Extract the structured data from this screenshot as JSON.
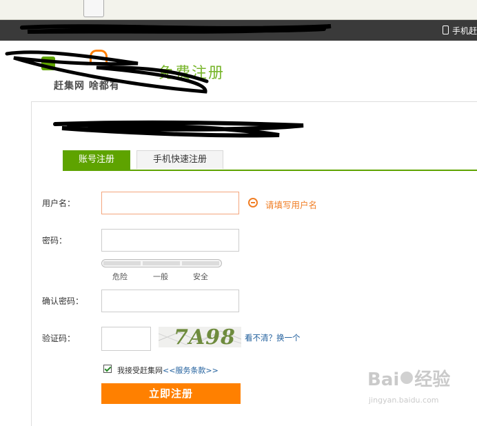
{
  "topbar": {
    "phone_text": "手机赶"
  },
  "header": {
    "page_title": "免费注册",
    "slogan": "赶集网 啥都有"
  },
  "tabs": [
    {
      "label": "账号注册"
    },
    {
      "label": "手机快速注册"
    }
  ],
  "form": {
    "username_label": "用户名：",
    "username_error": "请填写用户名",
    "password_label": "密码：",
    "strength_levels": [
      "危险",
      "一般",
      "安全"
    ],
    "confirm_label": "确认密码：",
    "captcha_label": "验证码：",
    "captcha_text": "7A98",
    "captcha_refresh": "看不清？换一个",
    "agree_prefix": "我接受赶集网",
    "agree_link": "<<服务条款>>",
    "submit_label": "立即注册"
  },
  "watermark": {
    "main_left": "Bai",
    "main_right": "经验",
    "url": "jingyan.baidu.com"
  },
  "colors": {
    "green": "#5ea300",
    "orange": "#ff8000",
    "error": "#f07d23",
    "link": "#1f5e9c"
  }
}
